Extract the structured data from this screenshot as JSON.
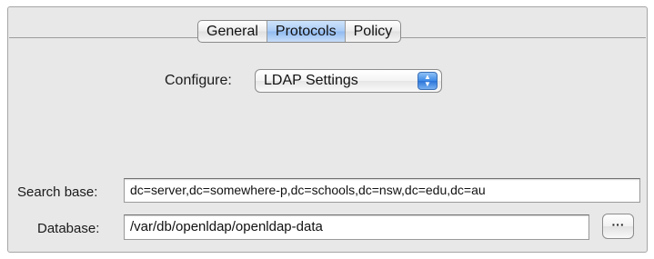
{
  "tabs": [
    {
      "label": "General"
    },
    {
      "label": "Protocols"
    },
    {
      "label": "Policy"
    }
  ],
  "configure": {
    "label": "Configure:",
    "value": "LDAP Settings",
    "arrows_icon": "up-down-arrows-icon"
  },
  "search_base": {
    "label": "Search base:",
    "value": "dc=server,dc=somewhere-p,dc=schools,dc=nsw,dc=edu,dc=au"
  },
  "database": {
    "label": "Database:",
    "value": "/var/db/openldap/openldap-data",
    "browse_label": "···"
  },
  "colors": {
    "selected_tab": "#a9cbf5",
    "panel_background": "#e8e8e8",
    "popup_arrows": "#3d8ae8"
  }
}
